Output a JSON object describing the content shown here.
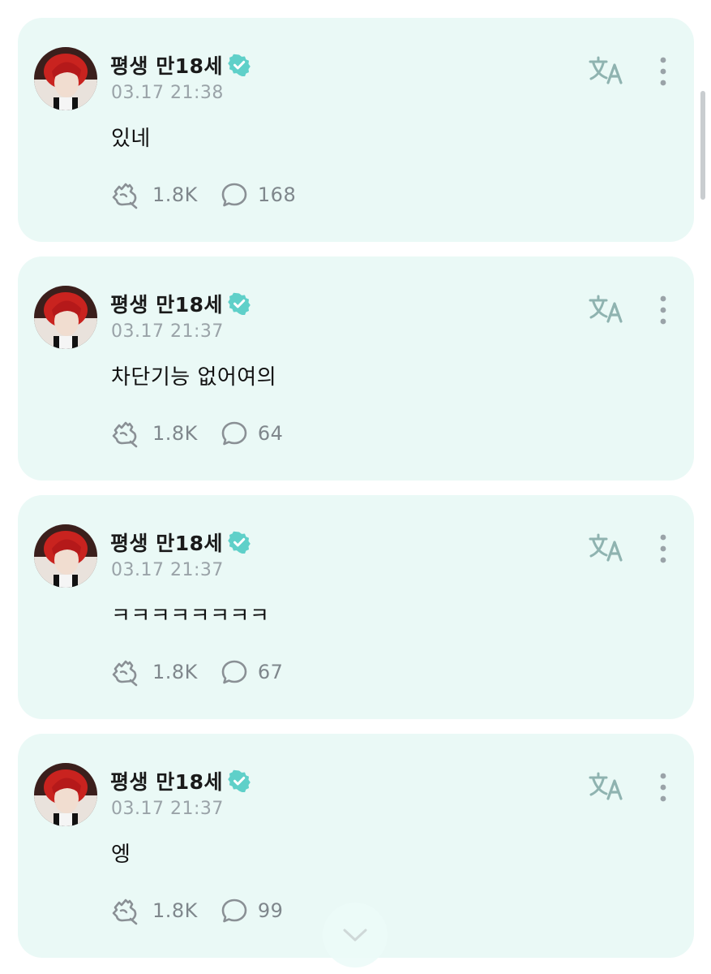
{
  "theme": {
    "card_background": "#eaf9f6",
    "accent": "#5fd0c9",
    "icon_color": "#8a9095"
  },
  "icons": {
    "verified": "verified-badge-icon",
    "translate": "translate-icon",
    "more": "more-vertical-icon",
    "reaction": "reaction-hand-icon",
    "comment": "comment-bubble-icon",
    "scroll": "chevron-down-icon"
  },
  "posts": [
    {
      "author": "평생 만18세",
      "timestamp": "03.17 21:38",
      "text": "있네",
      "reactions": "1.8K",
      "comments": "168"
    },
    {
      "author": "평생 만18세",
      "timestamp": "03.17 21:37",
      "text": "차단기능 없어여의",
      "reactions": "1.8K",
      "comments": "64"
    },
    {
      "author": "평생 만18세",
      "timestamp": "03.17 21:37",
      "text": "ㅋㅋㅋㅋㅋㅋㅋㅋ",
      "reactions": "1.8K",
      "comments": "67"
    },
    {
      "author": "평생 만18세",
      "timestamp": "03.17 21:37",
      "text": "엥",
      "reactions": "1.8K",
      "comments": "99"
    }
  ]
}
